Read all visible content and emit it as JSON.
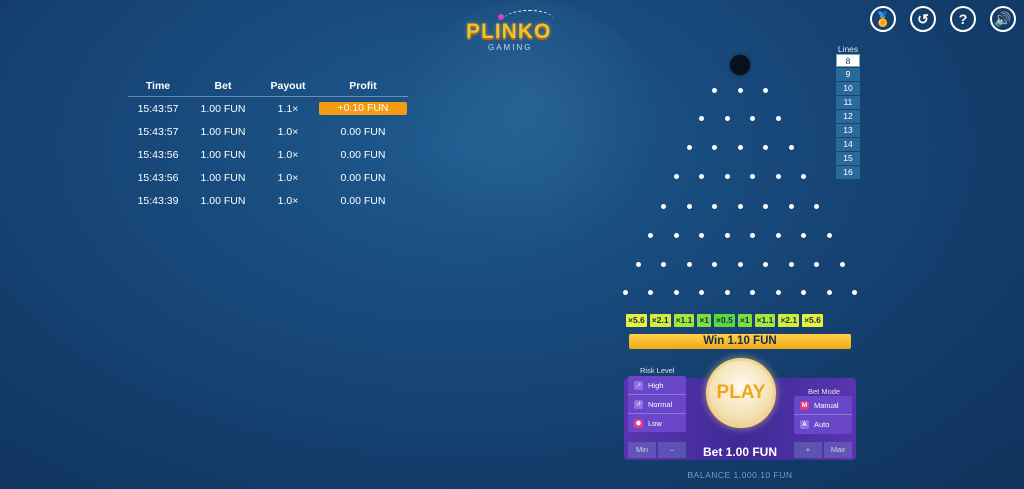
{
  "logo": {
    "title": "PLINKO",
    "subtitle": "GAMING"
  },
  "top_icons": [
    {
      "name": "medal-icon",
      "glyph": "🏅"
    },
    {
      "name": "history-icon",
      "glyph": "↺"
    },
    {
      "name": "help-icon",
      "glyph": "?"
    },
    {
      "name": "sound-icon",
      "glyph": "🔊"
    }
  ],
  "history": {
    "headers": [
      "Time",
      "Bet",
      "Payout",
      "Profit"
    ],
    "rows": [
      {
        "time": "15:43:57",
        "bet": "1.00 FUN",
        "payout": "1.1×",
        "profit": "+0.10 FUN"
      },
      {
        "time": "15:43:57",
        "bet": "1.00 FUN",
        "payout": "1.0×",
        "profit": "0.00 FUN"
      },
      {
        "time": "15:43:56",
        "bet": "1.00 FUN",
        "payout": "1.0×",
        "profit": "0.00 FUN"
      },
      {
        "time": "15:43:56",
        "bet": "1.00 FUN",
        "payout": "1.0×",
        "profit": "0.00 FUN"
      },
      {
        "time": "15:43:39",
        "bet": "1.00 FUN",
        "payout": "1.0×",
        "profit": "0.00 FUN"
      }
    ]
  },
  "lines": {
    "label": "Lines",
    "options": [
      "8",
      "9",
      "10",
      "11",
      "12",
      "13",
      "14",
      "15",
      "16"
    ],
    "selected": "8"
  },
  "multipliers": [
    {
      "label": "×5.6",
      "color": "#e8f23a"
    },
    {
      "label": "×2.1",
      "color": "#d2ee3a"
    },
    {
      "label": "×1.1",
      "color": "#a6e83a"
    },
    {
      "label": "×1",
      "color": "#7ee03a"
    },
    {
      "label": "×0.5",
      "color": "#5cd83a"
    },
    {
      "label": "×1",
      "color": "#7ee03a"
    },
    {
      "label": "×1.1",
      "color": "#a6e83a"
    },
    {
      "label": "×2.1",
      "color": "#d2ee3a"
    },
    {
      "label": "×5.6",
      "color": "#e8f23a"
    }
  ],
  "win_text": "Win 1.10 FUN",
  "risk": {
    "label": "Risk Level",
    "items": [
      "High",
      "Normal",
      "Low"
    ]
  },
  "play_label": "PLAY",
  "bet_mode": {
    "label": "Bet Mode",
    "items": [
      {
        "label": "Manual",
        "icon": "M"
      },
      {
        "label": "Auto",
        "icon": "A"
      }
    ]
  },
  "bet_text": "Bet 1.00 FUN",
  "buttons": {
    "min": "Min",
    "minus": "–",
    "plus": "+",
    "max": "Max"
  },
  "balance": "BALANCE 1,000.10 FUN"
}
